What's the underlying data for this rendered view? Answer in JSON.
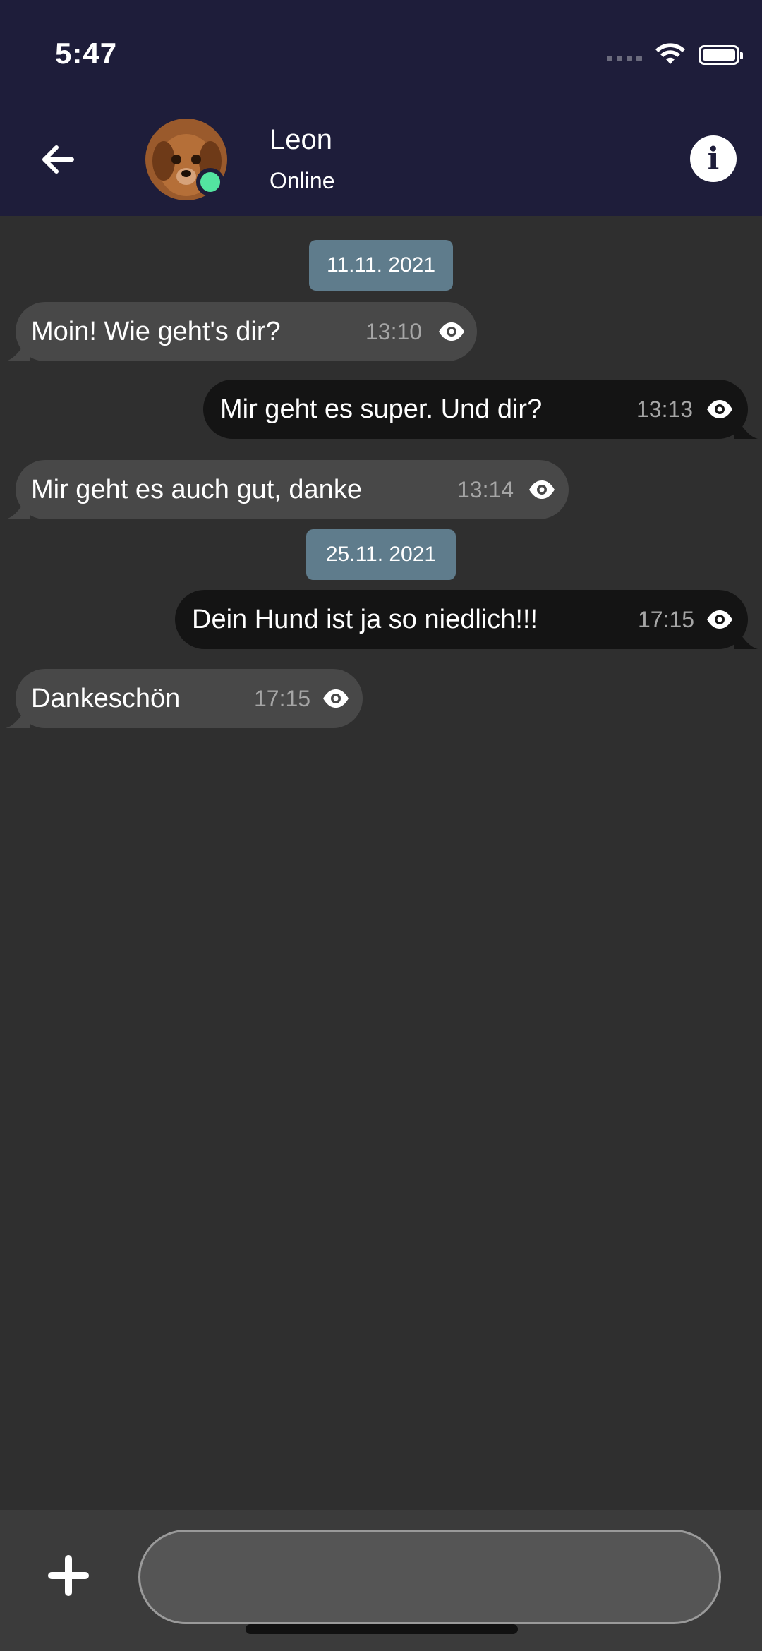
{
  "status_bar": {
    "time": "5:47"
  },
  "header": {
    "contact_name": "Leon",
    "contact_status": "Online",
    "back_icon": "arrow-left-icon",
    "info_icon": "info-icon"
  },
  "chat": {
    "date_chips": [
      "11.11. 2021",
      "25.11. 2021"
    ],
    "messages": [
      {
        "direction": "in",
        "text": "Moin! Wie geht's dir?",
        "time": "13:10",
        "status_icon": "eye-icon"
      },
      {
        "direction": "out",
        "text": "Mir geht es super. Und dir?",
        "time": "13:13",
        "status_icon": "eye-icon"
      },
      {
        "direction": "in",
        "text": "Mir geht es auch gut, danke",
        "time": "13:14",
        "status_icon": "eye-icon"
      },
      {
        "direction": "out",
        "text": "Dein Hund ist ja so niedlich!!!",
        "time": "17:15",
        "status_icon": "eye-icon"
      },
      {
        "direction": "in",
        "text": "Dankeschön",
        "time": "17:15",
        "status_icon": "eye-icon"
      }
    ]
  },
  "composer": {
    "add_icon": "plus-icon",
    "input_value": ""
  },
  "colors": {
    "header_bg": "#1e1d3a",
    "chat_bg": "#2f2f2f",
    "incoming_bubble": "#484848",
    "outgoing_bubble": "#141414",
    "date_chip": "#5f7c8c",
    "online": "#53e4a0"
  }
}
